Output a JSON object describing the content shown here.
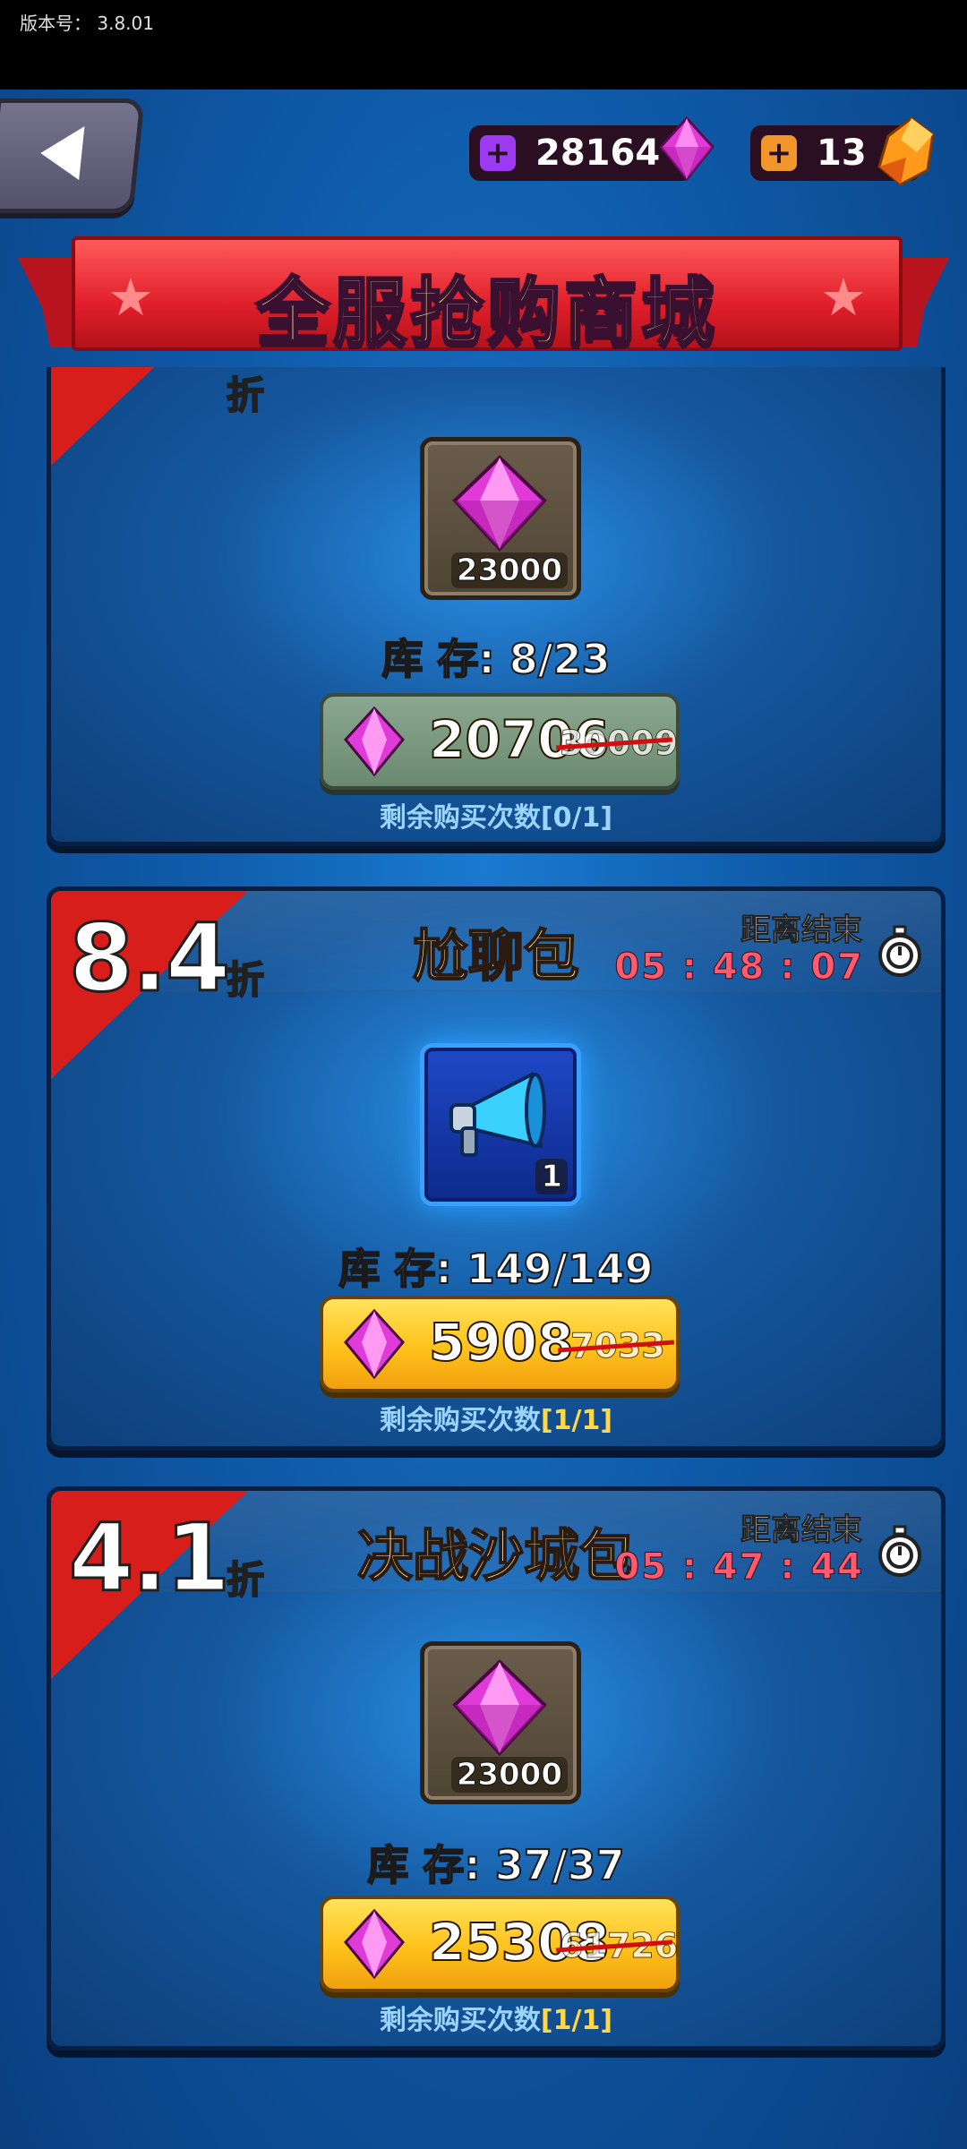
{
  "status_bar": {
    "version": "版本号： 3.8.01"
  },
  "header": {
    "back_icon": "back-arrow-icon",
    "currencies": [
      {
        "icon": "purple-plus-icon",
        "value": "28164",
        "gem": "pink-diamond-icon",
        "color": "#9b3af0"
      },
      {
        "icon": "orange-plus-icon",
        "value": "13",
        "gem": "orange-crystal-icon",
        "color": "#f0962a"
      }
    ]
  },
  "banner": {
    "title": "全服抢购商城"
  },
  "cards": [
    {
      "discount": "",
      "discount_unit": "折",
      "title": "",
      "item_icon": "pink-diamond-icon",
      "item_count": "23000",
      "stock_label": "库 存:",
      "stock": "8/23",
      "price": "20706",
      "old_price": "30009",
      "remaining_label": "剩余购买次数",
      "remaining": "[0/1]",
      "state": "sold-out"
    },
    {
      "discount": "8.4",
      "discount_unit": "折",
      "title": "尬聊包",
      "timer_label": "距离结束",
      "timer": "05 : 48 : 07",
      "item_icon": "megaphone-icon",
      "item_count": "1",
      "stock_label": "库 存:",
      "stock": "149/149",
      "price": "5908",
      "old_price": "7033",
      "remaining_label": "剩余购买次数",
      "remaining": "[1/1]",
      "state": "available"
    },
    {
      "discount": "4.1",
      "discount_unit": "折",
      "title": "决战沙城包",
      "timer_label": "距离结束",
      "timer": "05 : 47 : 44",
      "item_icon": "pink-diamond-icon",
      "item_count": "23000",
      "stock_label": "库 存:",
      "stock": "37/37",
      "price": "25308",
      "old_price": "61726",
      "remaining_label": "剩余购买次数",
      "remaining": "[1/1]",
      "state": "available"
    }
  ]
}
